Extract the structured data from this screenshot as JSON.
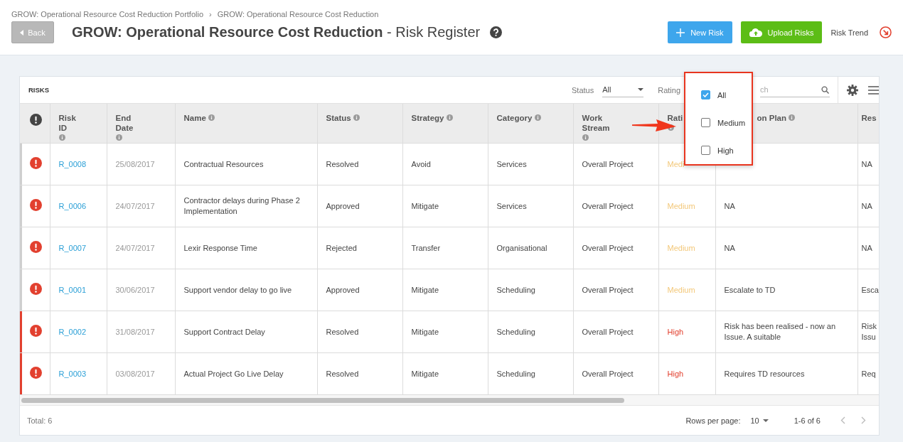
{
  "breadcrumbs": [
    "GROW: Operational Resource Cost Reduction Portfolio",
    "GROW: Operational Resource Cost Reduction"
  ],
  "breadcrumb_separator": "›",
  "back_button": "Back",
  "title": {
    "project": "GROW: Operational Resource Cost Reduction",
    "page": "- Risk Register"
  },
  "actions": {
    "new_risk": "New Risk",
    "upload_risks": "Upload Risks",
    "risk_trend": "Risk Trend"
  },
  "table": {
    "title": "RISKS",
    "status_filter": {
      "label": "Status",
      "value": "All"
    },
    "rating_filter": {
      "label": "Rating"
    },
    "search": {
      "placeholder": "ch"
    },
    "columns": [
      {
        "kind": "icon"
      },
      {
        "kind": "text",
        "label": "Risk ID",
        "info": true
      },
      {
        "kind": "text",
        "label": "End Date",
        "info": true
      },
      {
        "kind": "text",
        "label": "Name",
        "info": true
      },
      {
        "kind": "text",
        "label": "Status",
        "info": true
      },
      {
        "kind": "text",
        "label": "Strategy",
        "info": true
      },
      {
        "kind": "text",
        "label": "Category",
        "info": true
      },
      {
        "kind": "text",
        "label": "Work Stream",
        "info": true
      },
      {
        "kind": "text",
        "label": "Rati",
        "info": true
      },
      {
        "kind": "cut",
        "label": "on Plan",
        "info": true
      },
      {
        "kind": "text",
        "label": "Res",
        "info": false
      }
    ],
    "rows": [
      {
        "kind": "medium",
        "id": "R_0008",
        "end_date": "25/08/2017",
        "name": "Contractual Resources",
        "status": "Resolved",
        "strategy": "Avoid",
        "category": "Services",
        "work_stream": "Overall Project",
        "rating": "Medi",
        "res": "NA"
      },
      {
        "kind": "medium",
        "id": "R_0006",
        "end_date": "24/07/2017",
        "name": "Contractor delays during Phase 2 Implementation",
        "status": "Approved",
        "strategy": "Mitigate",
        "category": "Services",
        "work_stream": "Overall Project",
        "rating": "Medium",
        "plan": "NA",
        "res": "NA"
      },
      {
        "kind": "medium",
        "id": "R_0007",
        "end_date": "24/07/2017",
        "name": "Lexir Response Time",
        "status": "Rejected",
        "strategy": "Transfer",
        "category": "Organisational",
        "work_stream": "Overall Project",
        "rating": "Medium",
        "plan": "NA",
        "res": "NA"
      },
      {
        "kind": "medium",
        "id": "R_0001",
        "end_date": "30/06/2017",
        "name": "Support vendor delay to go live",
        "status": "Approved",
        "strategy": "Mitigate",
        "category": "Scheduling",
        "work_stream": "Overall Project",
        "rating": "Medium",
        "plan": "Escalate to TD",
        "res": "Esca"
      },
      {
        "kind": "high",
        "id": "R_0002",
        "end_date": "31/08/2017",
        "name": "Support Contract Delay",
        "status": "Resolved",
        "strategy": "Mitigate",
        "category": "Scheduling",
        "work_stream": "Overall Project",
        "rating": "High",
        "plan": "Risk has been realised - now an Issue. A suitable",
        "res": "Risk Issu"
      },
      {
        "kind": "high",
        "id": "R_0003",
        "end_date": "03/08/2017",
        "name": "Actual Project Go Live Delay",
        "status": "Resolved",
        "strategy": "Mitigate",
        "category": "Scheduling",
        "work_stream": "Overall Project",
        "rating": "High",
        "plan": "Requires TD resources",
        "res": "Req"
      }
    ],
    "footer": {
      "total": "Total: 6",
      "rows_per_page_label": "Rows per page:",
      "rows_per_page": "10",
      "range": "1-6 of 6"
    }
  },
  "rating_dropdown": {
    "options": [
      {
        "label": "All",
        "checked": true
      },
      {
        "label": "Medium",
        "checked": false
      },
      {
        "label": "High",
        "checked": false
      }
    ]
  }
}
